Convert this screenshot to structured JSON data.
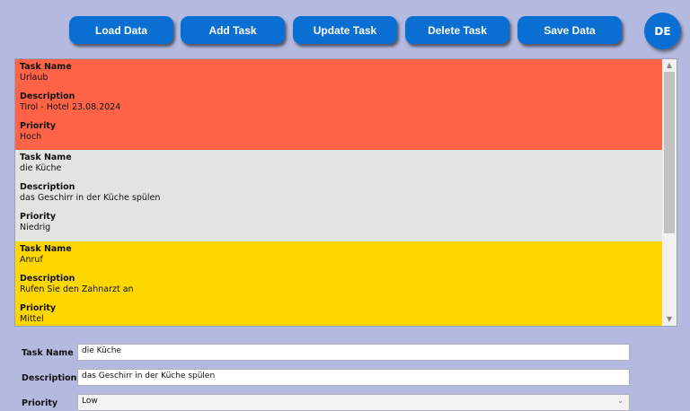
{
  "toolbar": {
    "buttons": [
      {
        "label": "Load Data"
      },
      {
        "label": "Add Task"
      },
      {
        "label": "Update Task"
      },
      {
        "label": "Delete Task"
      },
      {
        "label": "Save Data"
      }
    ],
    "language": "DE"
  },
  "labels": {
    "task_name": "Task Name",
    "description": "Description",
    "priority": "Priority"
  },
  "tasks": [
    {
      "name": "Urlaub",
      "description": "Tirol - Hotel 23.08.2024",
      "priority": "Hoch",
      "color": "#ff6347"
    },
    {
      "name": "die Küche",
      "description": "das Geschirr in der Küche spülen",
      "priority": "Niedrig",
      "color": "#e3e4e0"
    },
    {
      "name": "Anruf",
      "description": "Rufen Sie den Zahnarzt an",
      "priority": "Mittel",
      "color": "#ffd700"
    }
  ],
  "form": {
    "task_name_label": "Task Name",
    "description_label": "Description",
    "priority_label": "Priority",
    "task_name_value": "die Küche",
    "description_value": "das Geschirr in der Küche spülen",
    "priority_value": "Low"
  },
  "scroll": {
    "up_icon": "chevron-up-icon",
    "down_icon": "chevron-down-icon"
  }
}
